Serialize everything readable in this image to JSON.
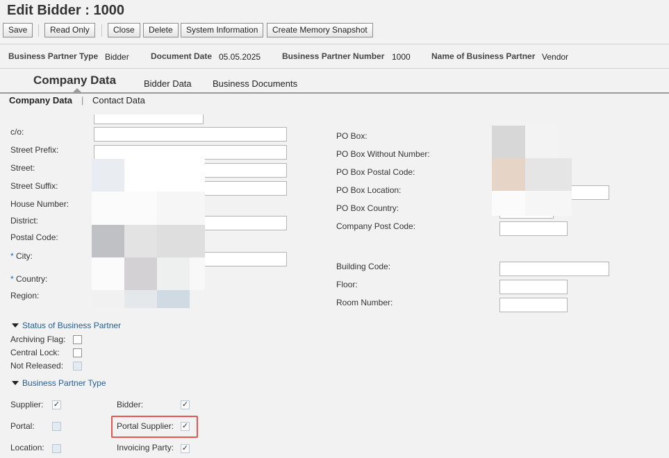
{
  "title": "Edit Bidder : 1000",
  "toolbar": {
    "save": "Save",
    "read_only": "Read Only",
    "close": "Close",
    "delete": "Delete",
    "system_information": "System Information",
    "create_memory_snapshot": "Create Memory Snapshot"
  },
  "info": {
    "bp_type_label": "Business Partner Type",
    "bp_type_value": "Bidder",
    "doc_date_label": "Document Date",
    "doc_date_value": "05.05.2025",
    "bp_number_label": "Business Partner Number",
    "bp_number_value": "1000",
    "bp_name_label": "Name of Business Partner",
    "bp_name_value": "Vendor"
  },
  "tabs": [
    "Company Data",
    "Bidder Data",
    "Business Documents"
  ],
  "subtabs": [
    "Company Data",
    "|",
    "Contact Data"
  ],
  "address": {
    "co": "c/o:",
    "street_prefix": "Street Prefix:",
    "street": "Street:",
    "street_suffix": "Street Suffix:",
    "house_number": "House Number:",
    "district": "District:",
    "postal_code": "Postal Code:",
    "city": "City:",
    "country": "Country:",
    "region": "Region:",
    "required_marker": "*"
  },
  "pobox": {
    "po_box": "PO Box:",
    "po_box_without_number": "PO Box Without Number:",
    "po_box_postal_code": "PO Box Postal Code:",
    "po_box_location": "PO Box Location:",
    "po_box_country": "PO Box Country:",
    "company_post_code": "Company Post Code:",
    "building_code": "Building Code:",
    "floor": "Floor:",
    "room_number": "Room Number:"
  },
  "status_section": {
    "title": "Status of Business Partner",
    "archiving_flag": "Archiving Flag:",
    "central_lock": "Central Lock:",
    "not_released": "Not Released:"
  },
  "type_section": {
    "title": "Business Partner Type",
    "supplier": "Supplier:",
    "portal": "Portal:",
    "location": "Location:",
    "bidder": "Bidder:",
    "portal_supplier": "Portal Supplier:",
    "invoicing_party": "Invoicing Party:"
  },
  "checkmark": "✓",
  "colors": {
    "accent": "#1f5d94",
    "required": "#0a6ed1",
    "highlight": "#e8524f"
  }
}
